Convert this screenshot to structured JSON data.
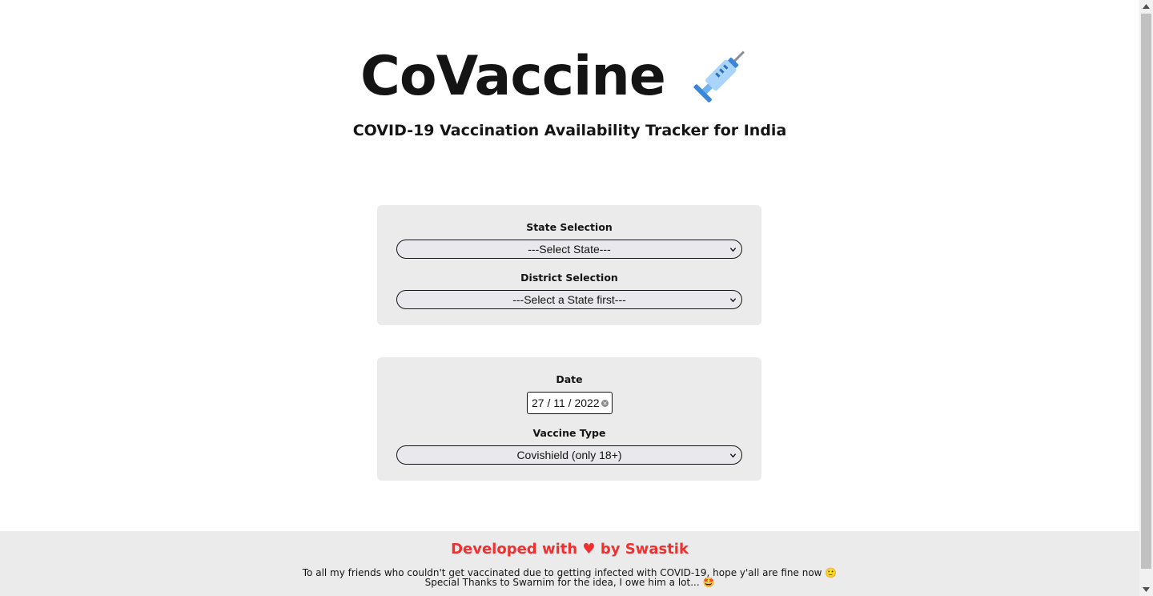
{
  "header": {
    "title": "CoVaccine",
    "title_icon": "syringe-icon",
    "subtitle": "COVID-19 Vaccination Availability Tracker for India"
  },
  "location_card": {
    "state_label": "State Selection",
    "state_value": "---Select State---",
    "district_label": "District Selection",
    "district_value": "---Select a State first---"
  },
  "options_card": {
    "date_label": "Date",
    "date_value": "27 / 11 / 2022",
    "vaccine_label": "Vaccine Type",
    "vaccine_value": "Covishield (only 18+)"
  },
  "footer": {
    "title": "Developed with ♥ by Swastik",
    "line1": "To all my friends who couldn't get vaccinated due to getting infected with COVID-19, hope y'all are fine now 🙂",
    "line2": "Special Thanks to Swarnim for the idea, I owe him a lot... 🤩"
  },
  "colors": {
    "accent": "#f22f2f",
    "card_bg": "#ebebeb",
    "text": "#141414"
  }
}
